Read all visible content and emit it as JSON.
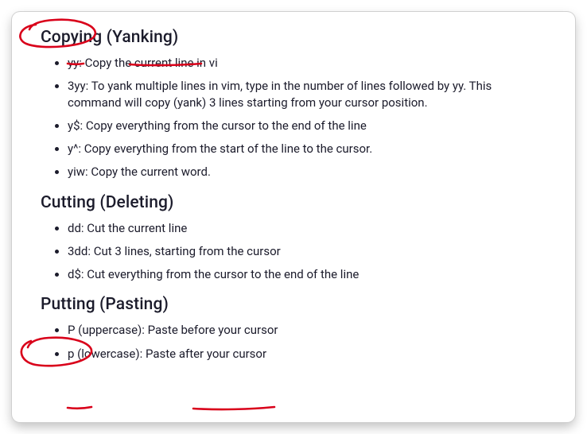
{
  "sections": [
    {
      "heading": "Copying (Yanking)",
      "items": [
        {
          "cmd": "yy",
          "desc": "Copy the current line in vi"
        },
        {
          "cmd": "3yy",
          "desc": "To yank multiple lines in vim, type in the number of lines followed by yy. This command will copy (yank) 3 lines starting from your cursor position."
        },
        {
          "cmd": "y$",
          "desc": "Copy everything from the cursor to the end of the line"
        },
        {
          "cmd": "y^",
          "desc": "Copy everything from the start of the line to the cursor."
        },
        {
          "cmd": "yiw",
          "desc": "Copy the current word."
        }
      ]
    },
    {
      "heading": "Cutting (Deleting)",
      "items": [
        {
          "cmd": "dd",
          "desc": "Cut the current line"
        },
        {
          "cmd": "3dd",
          "desc": "Cut 3 lines, starting from the cursor"
        },
        {
          "cmd": "d$",
          "desc": "Cut everything from the cursor to the end of the line"
        }
      ]
    },
    {
      "heading": "Putting (Pasting)",
      "items": [
        {
          "cmd": "P (uppercase)",
          "desc": "Paste before your cursor"
        },
        {
          "cmd": "p (lowercase)",
          "desc": "Paste after your cursor"
        }
      ]
    }
  ]
}
